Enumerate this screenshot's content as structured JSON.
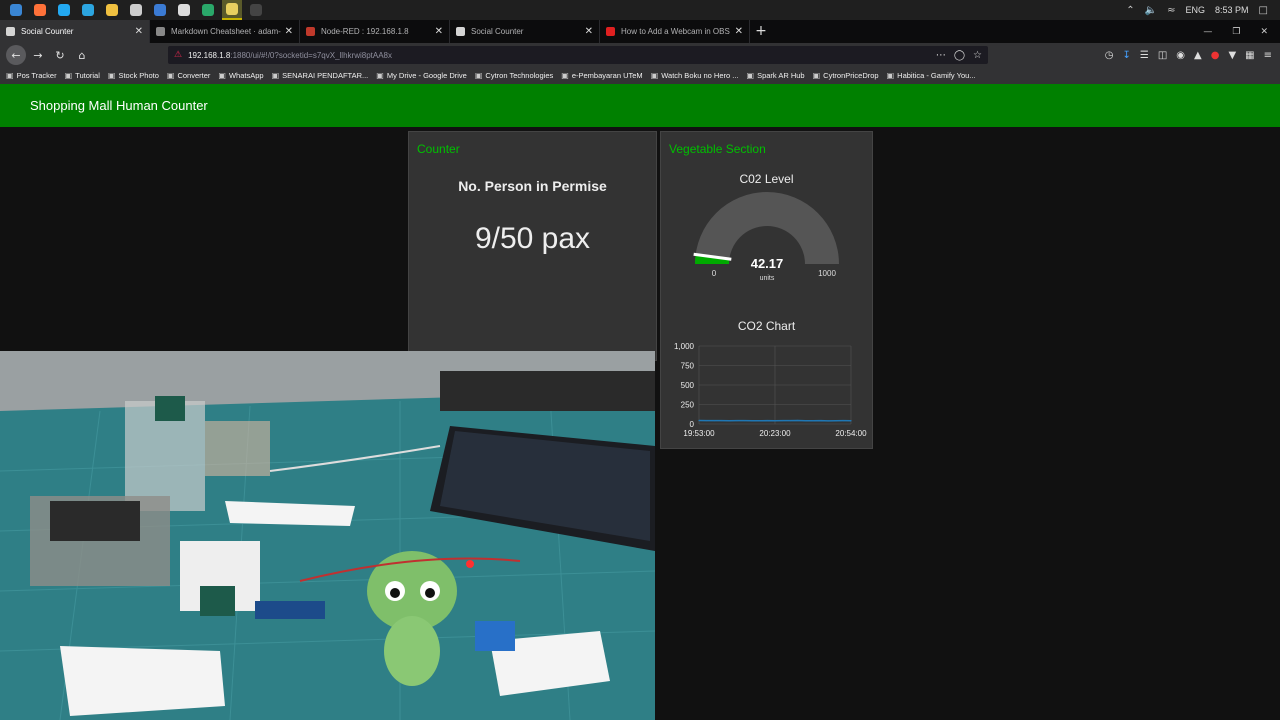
{
  "taskbar": {
    "apps": [
      {
        "icon": "windows-icon",
        "color": "#3a86d4"
      },
      {
        "icon": "firefox-icon",
        "color": "#ff7139"
      },
      {
        "icon": "vscode-icon",
        "color": "#23a9f2"
      },
      {
        "icon": "telegram-icon",
        "color": "#2ca5e0"
      },
      {
        "icon": "folder-icon",
        "color": "#f0c040"
      },
      {
        "icon": "terminal-icon",
        "color": "#cccccc"
      },
      {
        "icon": "app-icon",
        "color": "#3b7bd4"
      },
      {
        "icon": "cloud-icon",
        "color": "#dddddd"
      },
      {
        "icon": "sourcetree-icon",
        "color": "#2aa86a"
      },
      {
        "icon": "notepad-icon",
        "color": "#e8d060"
      },
      {
        "icon": "obs-icon",
        "color": "#444444"
      }
    ],
    "lang": "ENG",
    "time": "8:53 PM"
  },
  "tabs": [
    {
      "title": "Social Counter",
      "active": true,
      "color": "#d4d4d4"
    },
    {
      "title": "Markdown Cheatsheet · adam-p",
      "active": false,
      "color": "#888888"
    },
    {
      "title": "Node-RED : 192.168.1.8",
      "active": false,
      "color": "#c0392b"
    },
    {
      "title": "Social Counter",
      "active": false,
      "color": "#d4d4d4"
    },
    {
      "title": "How to Add a Webcam in OBS",
      "active": false,
      "color": "#e02020"
    }
  ],
  "url": {
    "host": "192.168.1.8",
    "rest": ":1880/ui/#!/0?socketid=s7qvX_llhkrwi8ptAA8x"
  },
  "bookmarks": [
    "Pos Tracker",
    "Tutorial",
    "Stock Photo",
    "Converter",
    "WhatsApp",
    "SENARAI PENDAFTAR...",
    "My Drive - Google Drive",
    "Cytron Technologies",
    "e-Pembayaran UTeM",
    "Watch Boku no Hero ...",
    "Spark AR Hub",
    "CytronPriceDrop",
    "Habitica - Gamify You..."
  ],
  "dashboard": {
    "title": "Shopping Mall Human Counter",
    "counter": {
      "group": "Counter",
      "label": "No. Person in Permise",
      "value": "9/50 pax"
    },
    "vegetable": {
      "group": "Vegetable Section",
      "gauge": {
        "label": "C02 Level",
        "value": 42.17,
        "value_text": "42.17",
        "units": "units",
        "min": 0,
        "max": 1000,
        "min_text": "0",
        "max_text": "1000",
        "fill_color": "#00aa00"
      },
      "chart_title": "CO2 Chart"
    }
  },
  "chart_data": {
    "type": "line",
    "title": "CO2 Chart",
    "xlabel": "",
    "ylabel": "",
    "x_ticks": [
      "19:53:00",
      "20:23:00",
      "20:54:00"
    ],
    "y_ticks": [
      "0",
      "250",
      "500",
      "750",
      "1,000"
    ],
    "ylim": [
      0,
      1000
    ],
    "grid": true,
    "series": [
      {
        "color": "#1f77b4",
        "x": [
          0,
          0.05,
          0.1,
          0.15,
          0.2,
          0.25,
          0.3,
          0.35,
          0.4,
          0.45,
          0.5,
          0.55,
          0.6,
          0.65,
          0.7,
          0.75,
          0.8,
          0.85,
          0.9,
          0.95,
          1.0
        ],
        "values": [
          45,
          44,
          43,
          44,
          42,
          43,
          44,
          42,
          41,
          43,
          42,
          44,
          43,
          45,
          41,
          42,
          43,
          40,
          42,
          43,
          42
        ]
      }
    ]
  }
}
